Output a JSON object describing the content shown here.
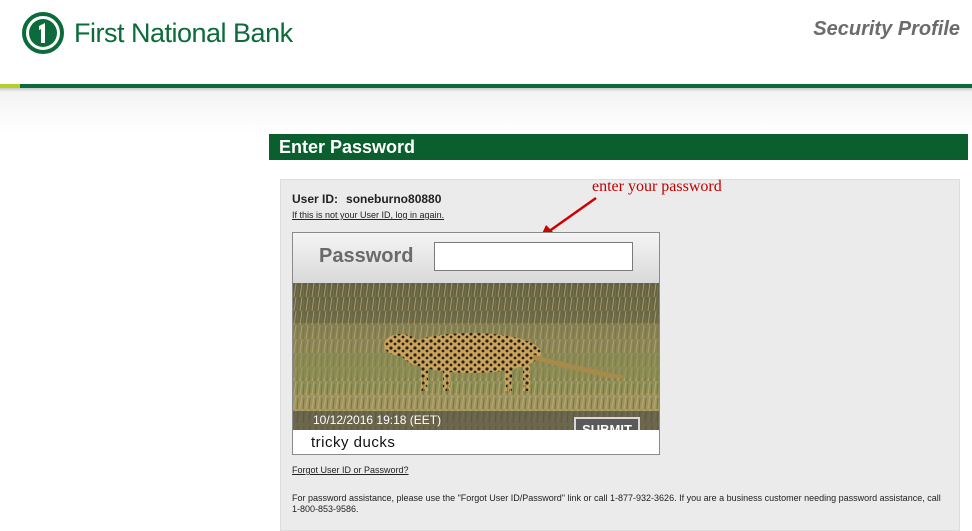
{
  "header": {
    "bank_name": "First National Bank",
    "section_title": "Security Profile"
  },
  "login": {
    "panel_title": "Enter Password",
    "user_id_label": "User ID:",
    "user_id_value": "soneburno80880",
    "relogin_link": "If this is not your User ID, log in again.",
    "password_label": "Password",
    "password_value": "",
    "timestamp": "10/12/2016 19:18 (EET)",
    "submit_label": "SUBMIT",
    "security_phrase": "tricky ducks",
    "forgot_link": "Forgot User ID or Password?",
    "assistance_text": "For password assistance, please use the \"Forgot User ID/Password\" link or call 1-877-932-3626. If you are a business customer needing password assistance, call 1-800-853-9586."
  },
  "annotation": {
    "text": "enter your password",
    "color": "#c00000"
  },
  "colors": {
    "brand_green": "#0b6b3a",
    "title_bar": "#0b5e2d",
    "accent_lime": "#b6cf2a"
  },
  "icons": {
    "logo": "first-national-bank-logo-icon",
    "arrow": "annotation-arrow-icon"
  }
}
